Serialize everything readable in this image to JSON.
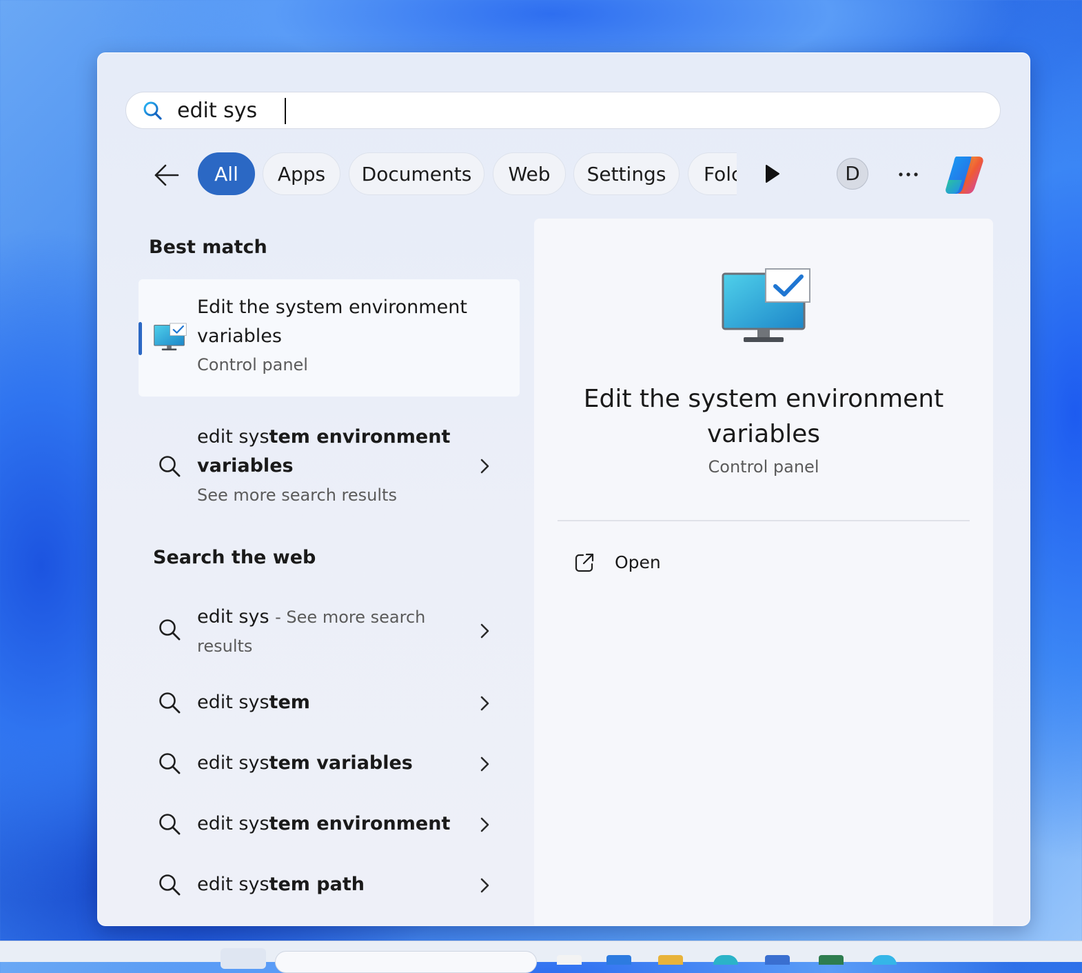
{
  "search": {
    "query": "edit sys"
  },
  "filters": {
    "back_label": "Back",
    "chips": [
      "All",
      "Apps",
      "Documents",
      "Web",
      "Settings",
      "Folc"
    ],
    "avatar_initial": "D"
  },
  "best_match": {
    "heading": "Best match",
    "title": "Edit the system environment variables",
    "subtitle": "Control panel"
  },
  "suggestion": {
    "typed": "edit sys",
    "rest": "tem environment variables",
    "subtitle": "See more search results"
  },
  "web": {
    "heading": "Search the web",
    "first": {
      "typed": "edit sys",
      "suffix": "- See more search results"
    },
    "items": [
      {
        "typed": "edit sys",
        "rest": "tem"
      },
      {
        "typed": "edit sys",
        "rest": "tem variables"
      },
      {
        "typed": "edit sys",
        "rest": "tem environment"
      },
      {
        "typed": "edit sys",
        "rest": "tem path"
      }
    ]
  },
  "preview": {
    "title": "Edit the system environment variables",
    "subtitle": "Control panel",
    "actions": [
      {
        "label": "Open",
        "icon": "open-external-icon"
      }
    ]
  },
  "colors": {
    "accent": "#2b68c4",
    "panel": "#eceff8"
  }
}
